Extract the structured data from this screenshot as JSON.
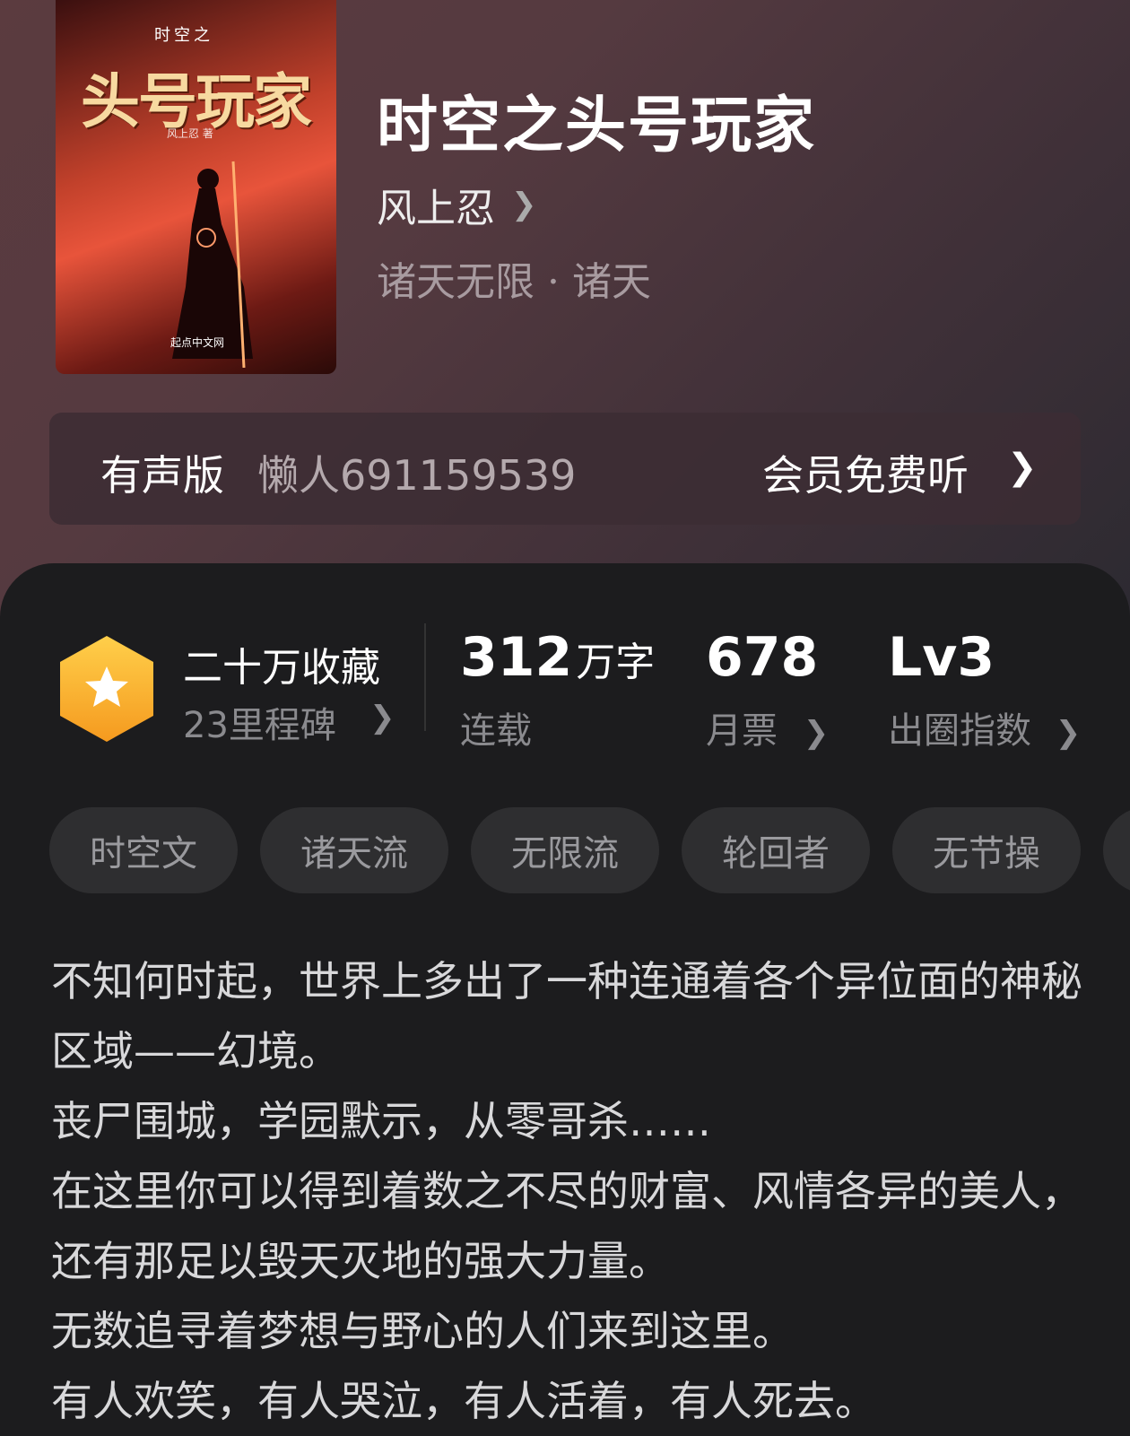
{
  "book": {
    "title": "时空之头号玩家",
    "author": "风上忍",
    "genre": "诸天无限 · 诸天",
    "cover": {
      "badge": "时空之",
      "title": "头号玩家",
      "author": "风上忍 著",
      "publisher": "起点中文网"
    }
  },
  "audio": {
    "label": "有声版",
    "narrator": "懒人691159539",
    "action": "会员免费听"
  },
  "stats": {
    "favorites": "二十万收藏",
    "milestone": "23里程碑",
    "word_count": "312",
    "word_unit": "万字",
    "status": "连载",
    "monthly_votes": "678",
    "monthly_votes_label": "月票",
    "level": "Lv3",
    "level_label": "出圈指数"
  },
  "tags": [
    "时空文",
    "诸天流",
    "无限流",
    "轮回者",
    "无节操"
  ],
  "intro": [
    "不知何时起，世界上多出了一种连通着各个异位面的神秘区域——幻境。",
    "丧尸围城，学园默示，从零哥杀……",
    "在这里你可以得到着数之不尽的财富、风情各异的美人，还有那足以毁天灭地的强大力量。",
    "无数追寻着梦想与野心的人们来到这里。",
    "有人欢笑，有人哭泣，有人活着，有人死去。"
  ],
  "colors": {
    "header_bg": "#553a40",
    "sheet_bg": "#1c1c1e",
    "badge_gold": "#f7b733",
    "tag_bg": "#2e2e30"
  }
}
